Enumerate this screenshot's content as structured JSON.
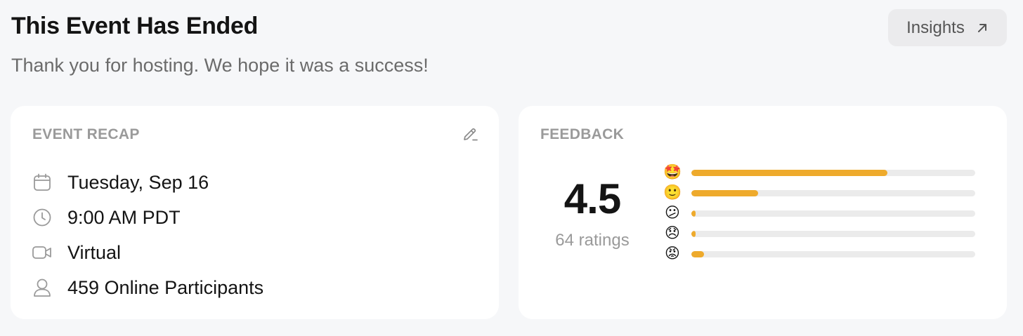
{
  "header": {
    "title": "This Event Has Ended",
    "subtitle": "Thank you for hosting. We hope it was a success!",
    "insights_label": "Insights"
  },
  "recap": {
    "heading": "EVENT RECAP",
    "date": "Tuesday, Sep 16",
    "time": "9:00 AM PDT",
    "location": "Virtual",
    "participants": "459 Online Participants"
  },
  "feedback": {
    "heading": "FEEDBACK",
    "score": "4.5",
    "ratings_label": "64 ratings",
    "accent_color": "#eeaa2c",
    "bars": [
      {
        "emoji": "🤩",
        "fraction": 0.69
      },
      {
        "emoji": "🙂",
        "fraction": 0.235
      },
      {
        "emoji": "😕",
        "fraction": 0.016
      },
      {
        "emoji": "😞",
        "fraction": 0.016
      },
      {
        "emoji": "😡",
        "fraction": 0.045
      }
    ]
  }
}
